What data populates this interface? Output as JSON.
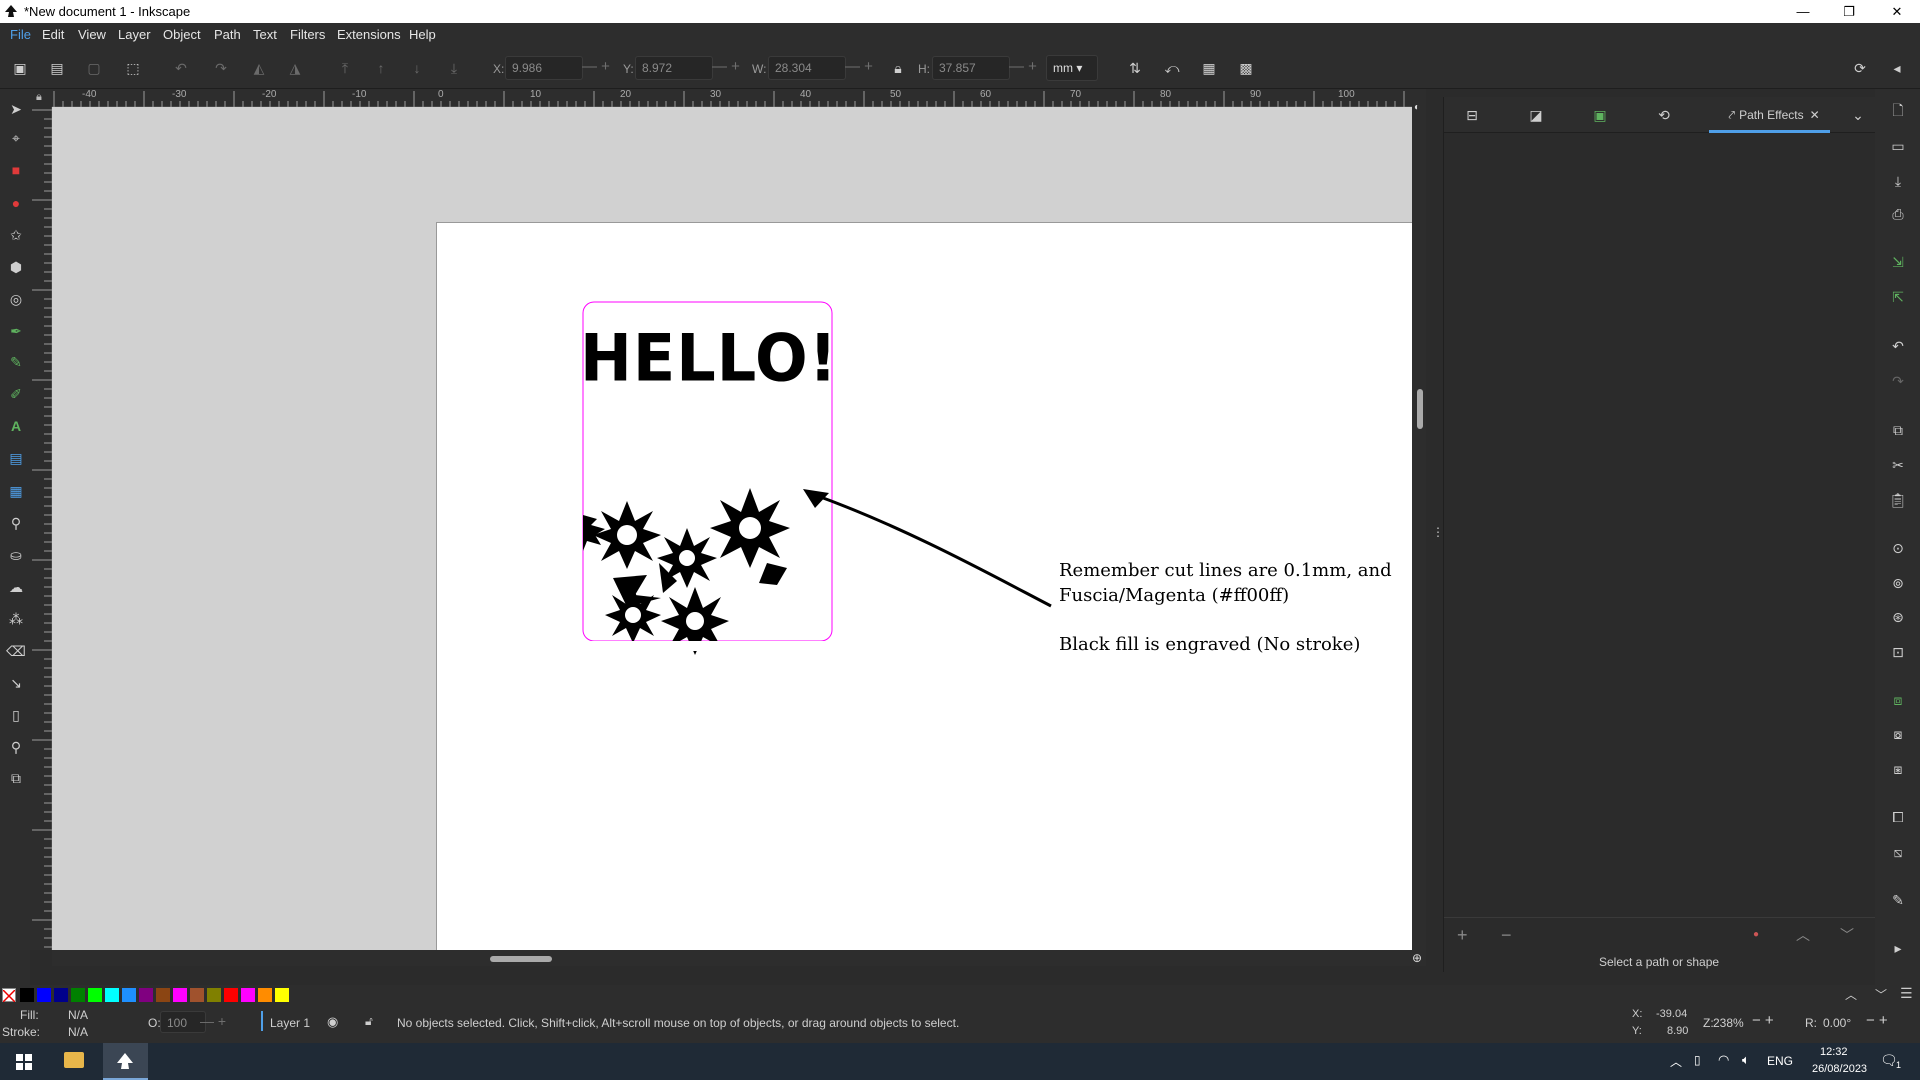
{
  "window": {
    "title": "*New document 1 - Inkscape",
    "minimize": "—",
    "maximize": "❐",
    "close": "✕"
  },
  "menu": [
    "File",
    "Edit",
    "View",
    "Layer",
    "Object",
    "Path",
    "Text",
    "Filters",
    "Extensions",
    "Help"
  ],
  "controls": {
    "x_label": "X:",
    "x_value": "9.986",
    "y_label": "Y:",
    "y_value": "8.972",
    "w_label": "W:",
    "w_value": "28.304",
    "h_label": "H:",
    "h_value": "37.857",
    "units": "mm"
  },
  "ruler": {
    "labels": [
      "-40",
      "-30",
      "-20",
      "-10",
      "0",
      "10",
      "20",
      "30",
      "40",
      "50",
      "60",
      "70",
      "80",
      "90",
      "100"
    ]
  },
  "canvas": {
    "card_text": "HELLO!",
    "note_line1": "Remember cut lines are 0.1mm, and",
    "note_line2": "Fuscia/Magenta (#ff00ff)",
    "note_line3": "Black fill is engraved (No stroke)",
    "cut_color": "#ff00ff"
  },
  "dock": {
    "active_tab": "Path Effects",
    "hint": "Select a path or shape"
  },
  "palette": [
    "#000000",
    "#0000ff",
    "#00008b",
    "#008000",
    "#00ff00",
    "#00ffff",
    "#1e90ff",
    "#800080",
    "#8b4513",
    "#ff00ff",
    "#a0522d",
    "#808000",
    "#ff0000",
    "#ff00ff",
    "#ff8c00",
    "#ffff00"
  ],
  "status": {
    "fill_label": "Fill:",
    "fill_value": "N/A",
    "stroke_label": "Stroke:",
    "stroke_value": "N/A",
    "opacity_label": "O:",
    "opacity_value": "100",
    "layer": "Layer 1",
    "message": "No objects selected. Click, Shift+click, Alt+scroll mouse on top of objects, or drag around objects to select.",
    "cursor_x_label": "X:",
    "cursor_x": "-39.04",
    "cursor_y_label": "Y:",
    "cursor_y": "8.90",
    "zoom_label": "Z:",
    "zoom": "238%",
    "rotate_label": "R:",
    "rotate": "0.00°"
  },
  "taskbar": {
    "lang": "ENG",
    "time": "12:32",
    "date": "26/08/2023",
    "notifications": "1"
  }
}
